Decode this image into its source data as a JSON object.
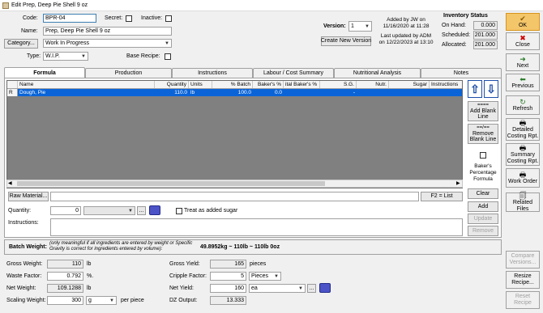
{
  "window": {
    "title": "Edit Prep, Deep Pie Shell 9 oz"
  },
  "header": {
    "code_label": "Code:",
    "code_value": "BPR-04",
    "secret_label": "Secret:",
    "inactive_label": "Inactive:",
    "name_label": "Name:",
    "name_value": "Prep, Deep Pie Shell 9 oz",
    "category_button": "Category...",
    "category_value": "Work In Progress",
    "type_label": "Type:",
    "type_value": "W.I.P.",
    "base_recipe_label": "Base Recipe:",
    "version_label": "Version:",
    "version_value": "1",
    "create_version_button": "Create New Version",
    "added_by_line1": "Added by JW on",
    "added_by_line2": "11/16/2020 at 11:28",
    "updated_line1": "Last updated by ADM",
    "updated_line2": "on 12/22/2023 at 13:10"
  },
  "inventory": {
    "title": "Inventory Status",
    "on_hand_label": "On Hand:",
    "on_hand_value": "0.000",
    "scheduled_label": "Scheduled:",
    "scheduled_value": "201.000",
    "allocated_label": "Allocated:",
    "allocated_value": "201.000"
  },
  "tabs": [
    "Formula",
    "Production",
    "Instructions",
    "Labour / Cost Summary",
    "Nutritional Analysis",
    "Notes"
  ],
  "grid": {
    "columns": [
      "Name",
      "Quantity",
      "Units",
      "% Batch",
      "Baker's %",
      "ital Baker's %",
      "S.G.",
      "Nutr.",
      "Sugar",
      "Instructions"
    ],
    "rows": [
      {
        "marker": "R",
        "name": "Dough, Pie",
        "quantity": "110.0",
        "units": "lb",
        "batch": "100.0",
        "bakers": "0.0",
        "total_bakers": "",
        "sg": "-"
      }
    ]
  },
  "grid_side": {
    "add_blank": "Add Blank Line",
    "remove_blank": "Remove Blank Line",
    "bakers_pct": "Baker's Percentage Formula"
  },
  "edit": {
    "raw_material_button": "Raw Material...",
    "f2_button": "F2 = List",
    "clear_button": "Clear",
    "quantity_label": "Quantity:",
    "quantity_value": "0",
    "treat_sugar_label": "Treat as added sugar",
    "add_button": "Add",
    "instructions_label": "Instructions:",
    "update_button": "Update",
    "remove_button": "Remove"
  },
  "batch": {
    "label": "Batch Weight:",
    "note": "(only meaningful if all ingredients are entered by weight or Specific Gravity is correct for ingredients entered by volume):",
    "value": "49.8952kg  ~  110lb  ~  110lb 0oz"
  },
  "yield": {
    "gross_weight_label": "Gross Weight:",
    "gross_weight_value": "110",
    "gross_weight_unit": "lb",
    "waste_label": "Waste Factor:",
    "waste_value": "0.792",
    "waste_unit": "%.",
    "net_weight_label": "Net Weight:",
    "net_weight_value": "109.1288",
    "net_weight_unit": "lb",
    "scaling_label": "Scaling Weight:",
    "scaling_value": "300",
    "scaling_unit": "g",
    "scaling_suffix": "per piece",
    "gross_yield_label": "Gross Yield:",
    "gross_yield_value": "165",
    "gross_yield_unit": "pieces",
    "cripple_label": "Cripple Factor:",
    "cripple_value": "5",
    "cripple_unit": "Pieces",
    "net_yield_label": "Net Yield:",
    "net_yield_value": "160",
    "net_yield_unit": "ea",
    "dz_label": "DZ Output:",
    "dz_value": "13.333"
  },
  "sidebar": {
    "ok": "OK",
    "close": "Close",
    "next": "Next",
    "previous": "Previous",
    "refresh": "Refresh",
    "detailed": "Detailed Costing Rpt.",
    "summary": "Summary Costing Rpt.",
    "work_order": "Work Order",
    "related": "Related Files",
    "compare": "Compare Versions...",
    "resize": "Resize Recipe...",
    "reset": "Reset Recipe"
  }
}
